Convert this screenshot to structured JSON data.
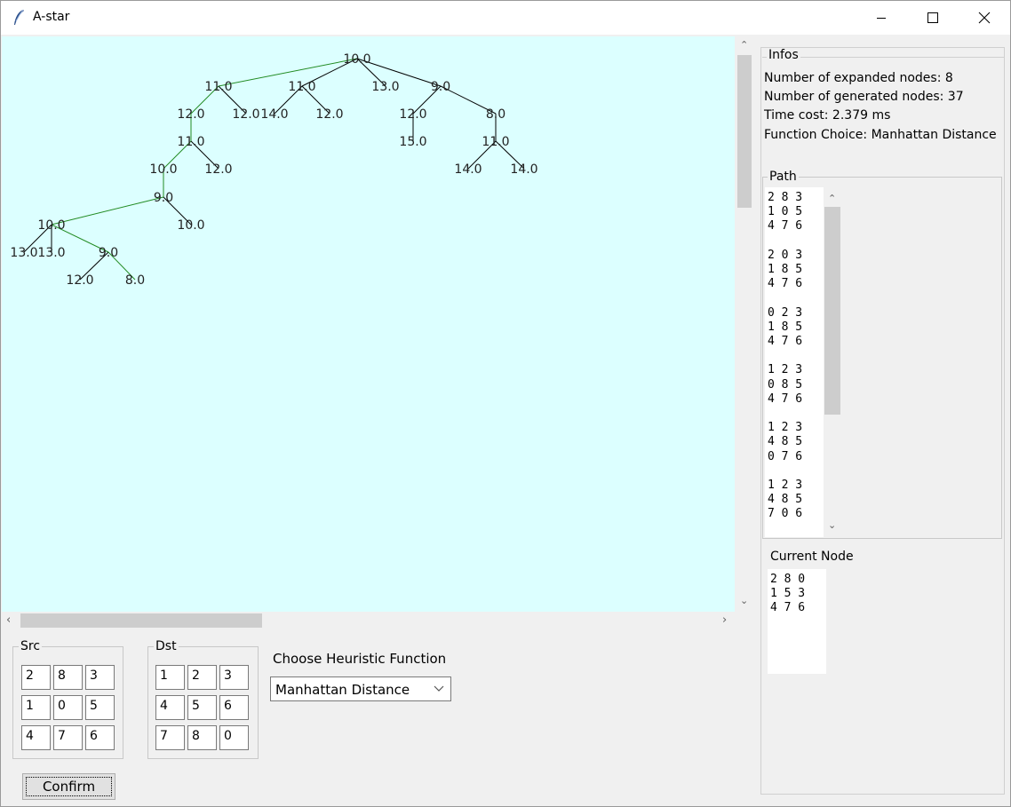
{
  "window": {
    "title": "A-star",
    "icon": "feather-icon",
    "controls": [
      "minimize-icon",
      "maximize-icon",
      "close-icon"
    ]
  },
  "tree": {
    "nodes": [
      {
        "id": "root",
        "label": "10.0"
      },
      {
        "id": "n1",
        "label": "11.0"
      },
      {
        "id": "n2",
        "label": "11.0"
      },
      {
        "id": "n3",
        "label": "13.0"
      },
      {
        "id": "n4",
        "label": "9.0"
      },
      {
        "id": "n5",
        "label": "12.0"
      },
      {
        "id": "n6",
        "label": "12.0"
      },
      {
        "id": "n7",
        "label": "14.0"
      },
      {
        "id": "n8",
        "label": "12.0"
      },
      {
        "id": "n9",
        "label": "12.0"
      },
      {
        "id": "n10",
        "label": "8.0"
      },
      {
        "id": "n11",
        "label": "11.0"
      },
      {
        "id": "n12",
        "label": "15.0"
      },
      {
        "id": "n13",
        "label": "11.0"
      },
      {
        "id": "n14",
        "label": "10.0"
      },
      {
        "id": "n15",
        "label": "12.0"
      },
      {
        "id": "n16",
        "label": "14.0"
      },
      {
        "id": "n17",
        "label": "14.0"
      },
      {
        "id": "n18",
        "label": "9.0"
      },
      {
        "id": "n19",
        "label": "10.0"
      },
      {
        "id": "n20",
        "label": "10.0"
      },
      {
        "id": "n21",
        "label": "13.0"
      },
      {
        "id": "n22",
        "label": "13.0"
      },
      {
        "id": "n23",
        "label": "9.0"
      },
      {
        "id": "n24",
        "label": "12.0"
      },
      {
        "id": "n25",
        "label": "8.0"
      }
    ],
    "edges": [
      [
        "root",
        "n1",
        "path"
      ],
      [
        "root",
        "n2",
        "plain"
      ],
      [
        "root",
        "n3",
        "plain"
      ],
      [
        "root",
        "n4",
        "plain"
      ],
      [
        "n1",
        "n5",
        "path"
      ],
      [
        "n1",
        "n6",
        "plain"
      ],
      [
        "n2",
        "n7",
        "plain"
      ],
      [
        "n2",
        "n8",
        "plain"
      ],
      [
        "n4",
        "n9",
        "plain"
      ],
      [
        "n4",
        "n10",
        "plain"
      ],
      [
        "n5",
        "n11",
        "path"
      ],
      [
        "n9",
        "n12",
        "plain"
      ],
      [
        "n10",
        "n13",
        "plain"
      ],
      [
        "n11",
        "n14",
        "path"
      ],
      [
        "n11",
        "n15",
        "plain"
      ],
      [
        "n13",
        "n16",
        "plain"
      ],
      [
        "n13",
        "n17",
        "plain"
      ],
      [
        "n14",
        "n18",
        "path"
      ],
      [
        "n18",
        "n20",
        "path"
      ],
      [
        "n18",
        "n19",
        "plain"
      ],
      [
        "n20",
        "n21",
        "plain"
      ],
      [
        "n20",
        "n22",
        "plain"
      ],
      [
        "n20",
        "n23",
        "path"
      ],
      [
        "n23",
        "n24",
        "plain"
      ],
      [
        "n23",
        "n25",
        "path"
      ]
    ],
    "colors": {
      "path": "#228b22",
      "plain": "#000000",
      "background": "#dcffff"
    }
  },
  "src": {
    "title": "Src",
    "cells": [
      "2",
      "8",
      "3",
      "1",
      "0",
      "5",
      "4",
      "7",
      "6"
    ]
  },
  "dst": {
    "title": "Dst",
    "cells": [
      "1",
      "2",
      "3",
      "4",
      "5",
      "6",
      "7",
      "8",
      "0"
    ]
  },
  "heuristic": {
    "label": "Choose Heuristic Function",
    "selected": "Manhattan Distance"
  },
  "confirm_label": "Confirm",
  "infos": {
    "title": "Infos",
    "lines": [
      "Number of expanded nodes: 8",
      "Number of generated nodes: 37",
      "Time cost: 2.379 ms",
      "Function Choice: Manhattan Distance"
    ]
  },
  "path": {
    "title": "Path",
    "text": "2 8 3\n1 0 5\n4 7 6\n\n2 0 3\n1 8 5\n4 7 6\n\n0 2 3\n1 8 5\n4 7 6\n\n1 2 3\n0 8 5\n4 7 6\n\n1 2 3\n4 8 5\n0 7 6\n\n1 2 3\n4 8 5\n7 0 6"
  },
  "current_node": {
    "title": "Current Node",
    "text": "2 8 0\n1 5 3\n4 7 6"
  }
}
